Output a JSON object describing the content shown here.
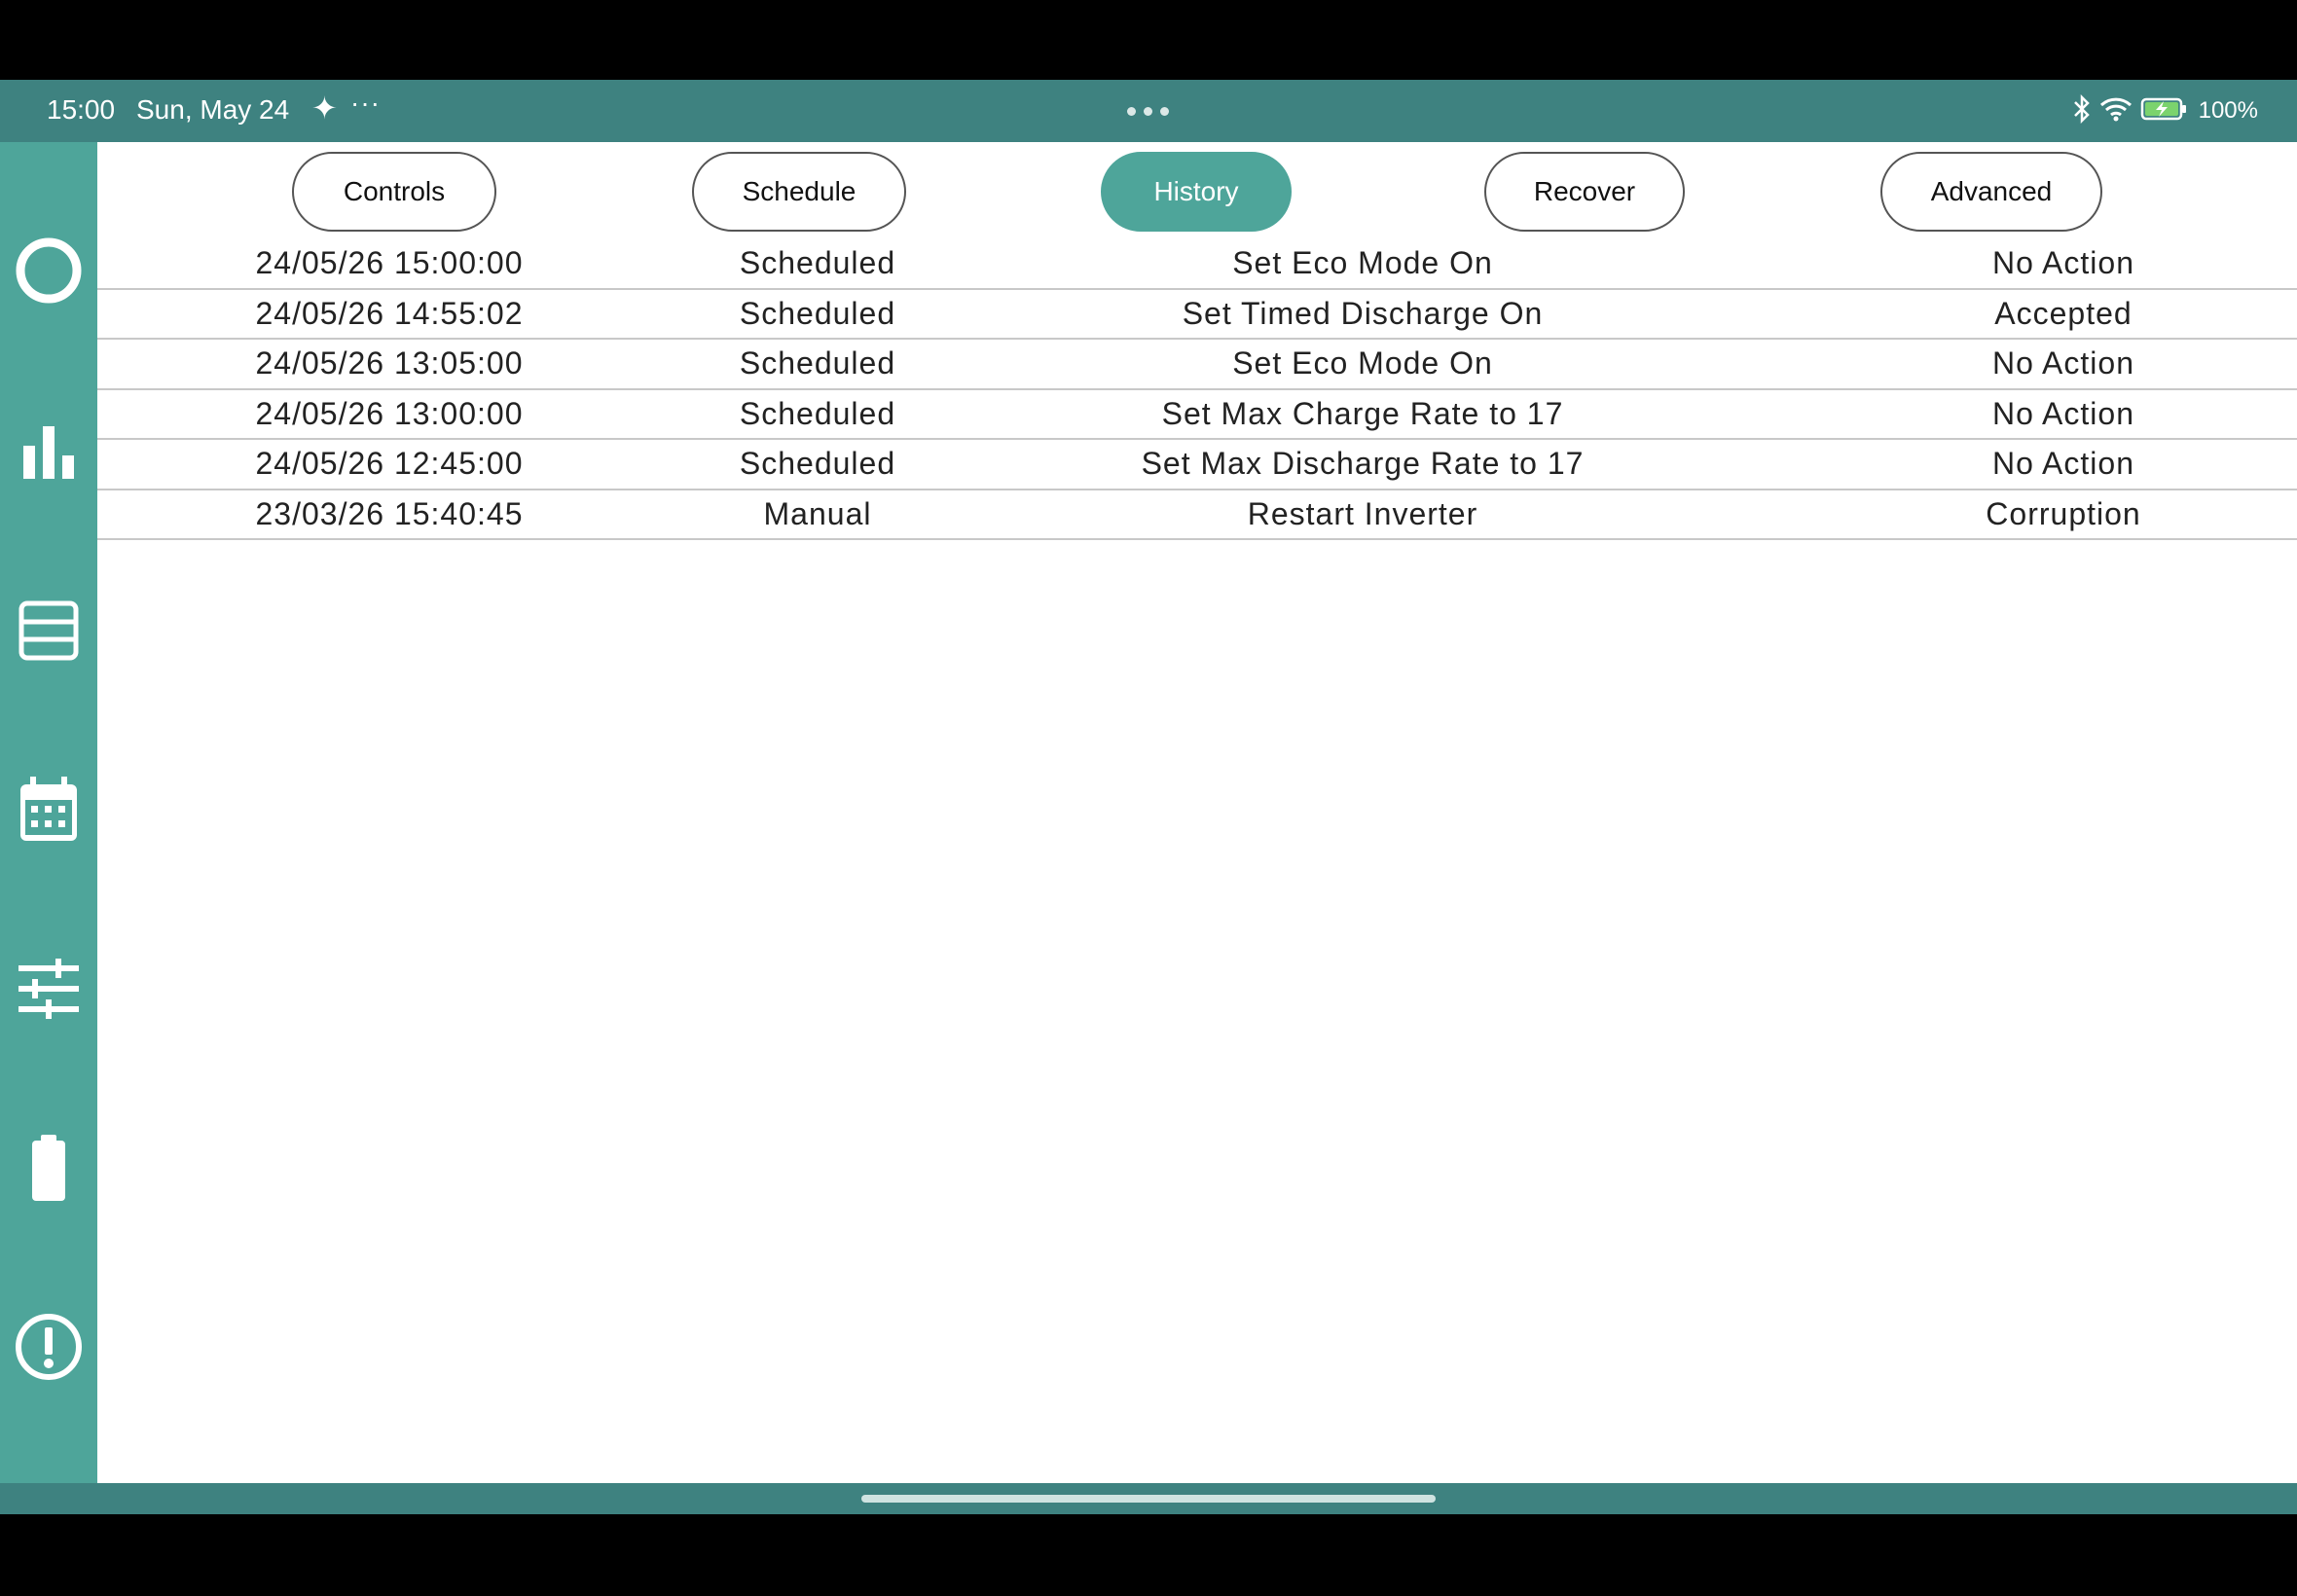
{
  "status_bar": {
    "time": "15:00",
    "date": "Sun, May 24",
    "battery": "100%",
    "icons": [
      "bluetooth-icon",
      "wifi-icon",
      "battery-charging-icon"
    ]
  },
  "sidebar": {
    "items": [
      {
        "name": "home",
        "icon": "circle-icon"
      },
      {
        "name": "stats",
        "icon": "bar-chart-icon"
      },
      {
        "name": "list",
        "icon": "list-icon"
      },
      {
        "name": "calendar",
        "icon": "calendar-icon"
      },
      {
        "name": "settings",
        "icon": "sliders-icon"
      },
      {
        "name": "battery",
        "icon": "battery-icon"
      },
      {
        "name": "alerts",
        "icon": "alert-icon"
      }
    ]
  },
  "tabs": [
    {
      "label": "Controls",
      "active": false
    },
    {
      "label": "Schedule",
      "active": false
    },
    {
      "label": "History",
      "active": true
    },
    {
      "label": "Recover",
      "active": false
    },
    {
      "label": "Advanced",
      "active": false
    }
  ],
  "history": {
    "rows": [
      {
        "time": "24/05/26 15:00:00",
        "type": "Scheduled",
        "action": "Set Eco Mode On",
        "result": "No Action"
      },
      {
        "time": "24/05/26 14:55:02",
        "type": "Scheduled",
        "action": "Set Timed Discharge On",
        "result": "Accepted"
      },
      {
        "time": "24/05/26 13:05:00",
        "type": "Scheduled",
        "action": "Set Eco Mode On",
        "result": "No Action"
      },
      {
        "time": "24/05/26 13:00:00",
        "type": "Scheduled",
        "action": "Set Max Charge Rate to 17",
        "result": "No Action"
      },
      {
        "time": "24/05/26 12:45:00",
        "type": "Scheduled",
        "action": "Set Max Discharge Rate to 17",
        "result": "No Action"
      },
      {
        "time": "23/03/26 15:40:45",
        "type": "Manual",
        "action": "Restart Inverter",
        "result": "Corruption"
      }
    ]
  },
  "colors": {
    "accent": "#4ea59a",
    "status_bar": "#3e8280"
  }
}
